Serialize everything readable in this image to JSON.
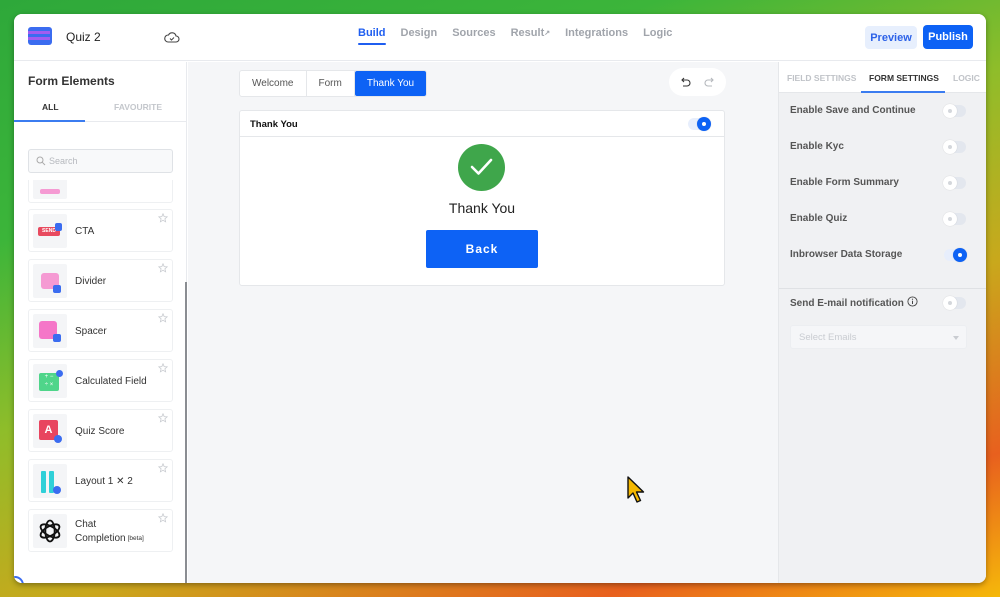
{
  "header": {
    "form_title": "Quiz 2",
    "nav": [
      {
        "label": "Build",
        "active": true
      },
      {
        "label": "Design",
        "active": false
      },
      {
        "label": "Sources",
        "active": false
      },
      {
        "label": "Result",
        "active": false,
        "external": true
      },
      {
        "label": "Integrations",
        "active": false
      },
      {
        "label": "Logic",
        "active": false
      }
    ],
    "preview_label": "Preview",
    "publish_label": "Publish"
  },
  "sidebar": {
    "title": "Form Elements",
    "tabs": {
      "all": "ALL",
      "favourite": "FAVOURITE"
    },
    "search_placeholder": "Search",
    "items": [
      {
        "label": "",
        "icon": "partial-element-icon"
      },
      {
        "label": "CTA",
        "icon": "cta-send-icon"
      },
      {
        "label": "Divider",
        "icon": "divider-icon"
      },
      {
        "label": "Spacer",
        "icon": "spacer-icon"
      },
      {
        "label": "Calculated Field",
        "icon": "calculator-icon"
      },
      {
        "label": "Quiz Score",
        "icon": "quiz-score-icon"
      },
      {
        "label": "Layout 1 ✕ 2",
        "icon": "layout-columns-icon"
      },
      {
        "label": "Chat Completion",
        "badge": "[beta]",
        "icon": "openai-icon"
      }
    ]
  },
  "canvas": {
    "steps": [
      {
        "label": "Welcome",
        "active": false
      },
      {
        "label": "Form",
        "active": false
      },
      {
        "label": "Thank You",
        "active": true
      }
    ],
    "card": {
      "title": "Thank You",
      "enabled": true,
      "message": "Thank You",
      "button_label": "Back"
    }
  },
  "right_panel": {
    "tabs": {
      "field": "FIELD SETTINGS",
      "form": "FORM SETTINGS",
      "logic": "LOGIC"
    },
    "active_tab": "FORM SETTINGS",
    "settings": [
      {
        "label": "Enable Save and Continue",
        "enabled": false
      },
      {
        "label": "Enable Kyc",
        "enabled": false
      },
      {
        "label": "Enable Form Summary",
        "enabled": false
      },
      {
        "label": "Enable Quiz",
        "enabled": false
      },
      {
        "label": "Inbrowser Data Storage",
        "enabled": true
      }
    ],
    "email_notification": {
      "label": "Send E-mail notification",
      "enabled": false
    },
    "select_emails_placeholder": "Select Emails"
  },
  "colors": {
    "primary": "#0d62f5",
    "success": "#3fa64b"
  }
}
